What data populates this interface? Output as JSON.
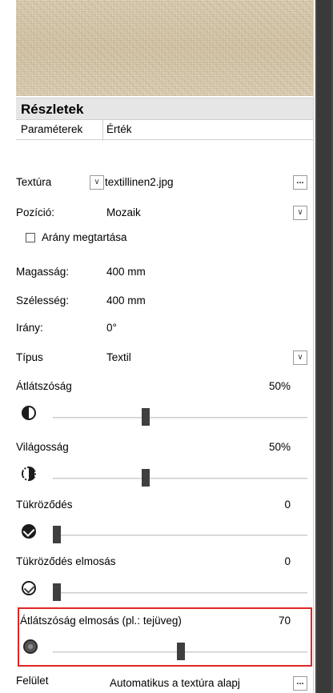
{
  "section": {
    "title": "Részletek"
  },
  "columns": {
    "param": "Paraméterek",
    "value": "Érték"
  },
  "texture": {
    "label": "Textúra",
    "value": "textillinen2.jpg",
    "dropdown_icon": "chevron-down-icon",
    "browse_label": "..."
  },
  "position": {
    "label": "Pozíció:",
    "value": "Mozaik"
  },
  "keep_ratio": {
    "label": "Arány megtartása",
    "checked": false
  },
  "height": {
    "label": "Magasság:",
    "value": "400 mm"
  },
  "width": {
    "label": "Szélesség:",
    "value": "400 mm"
  },
  "direction": {
    "label": "Irány:",
    "value": "0°"
  },
  "type": {
    "label": "Típus",
    "value": "Textil"
  },
  "sliders": {
    "transparency": {
      "label": "Átlátszóság",
      "value": "50%",
      "level": 0.5
    },
    "brightness": {
      "label": "Világosság",
      "value": "50%",
      "level": 0.5
    },
    "reflection": {
      "label": "Tükröződés",
      "value": "0",
      "level": 0
    },
    "reflection_blur": {
      "label": "Tükröződés elmosás",
      "value": "0",
      "level": 0
    },
    "transparency_blur": {
      "label": "Átlátszóság elmosás (pl.: tejüveg)",
      "value": "70",
      "level": 0.7
    }
  },
  "surface": {
    "label": "Felület",
    "value": "Automatikus a textúra alapj",
    "browse_label": "..."
  },
  "colors": {
    "highlight": "#e32525",
    "thumb": "#3f3f3f",
    "header_bg": "#e6e6e6"
  }
}
